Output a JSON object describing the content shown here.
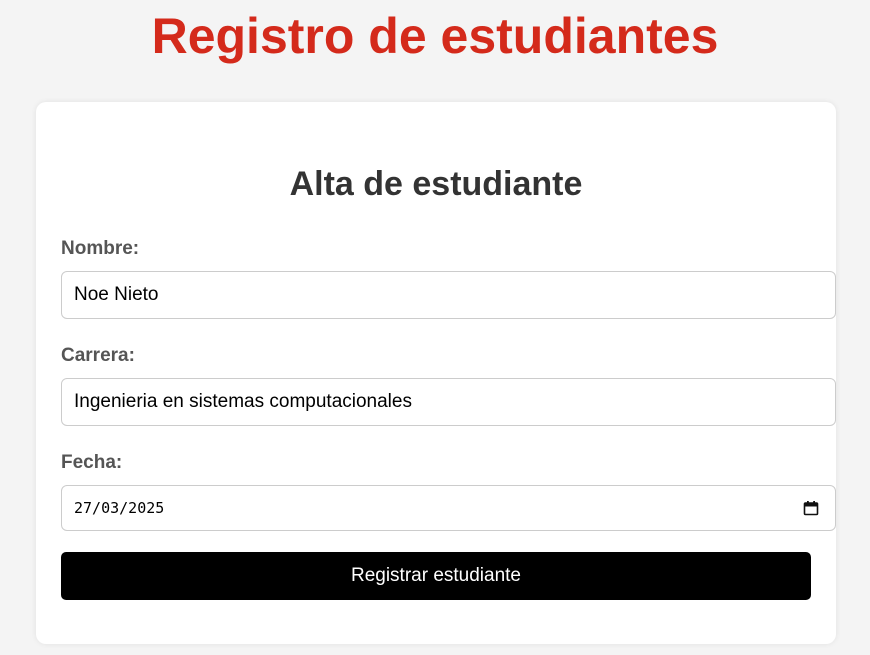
{
  "header": {
    "title": "Registro de estudiantes"
  },
  "form": {
    "title": "Alta de estudiante",
    "nombre": {
      "label": "Nombre:",
      "value": "Noe Nieto"
    },
    "carrera": {
      "label": "Carrera:",
      "value": "Ingenieria en sistemas computacionales"
    },
    "fecha": {
      "label": "Fecha:",
      "value": "27/03/2025",
      "icon": "calendar-icon"
    },
    "submit_label": "Registrar estudiante"
  },
  "colors": {
    "title": "#d42a1b",
    "background": "#f4f4f4",
    "card": "#ffffff",
    "button": "#000000",
    "button_text": "#ffffff",
    "label": "#555555",
    "heading": "#333333"
  }
}
